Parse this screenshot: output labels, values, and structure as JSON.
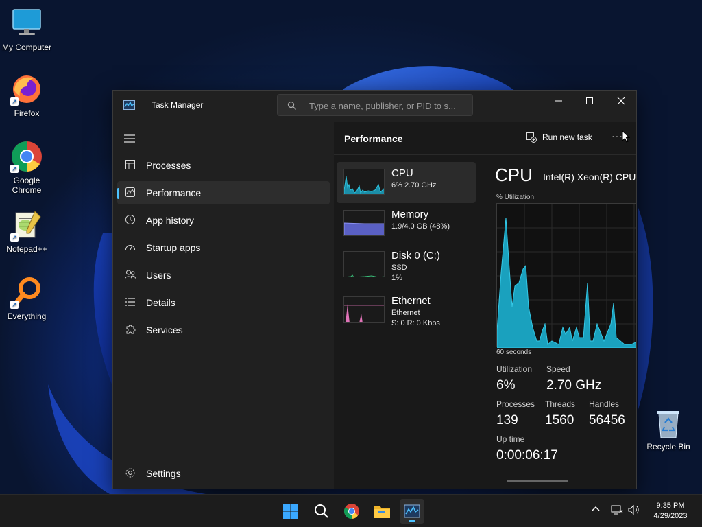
{
  "desktop": {
    "icons": [
      {
        "label": "My Computer",
        "icon": "monitor-icon"
      },
      {
        "label": "Firefox",
        "icon": "firefox-icon"
      },
      {
        "label": "Google\nChrome",
        "icon": "chrome-icon"
      },
      {
        "label": "Notepad++",
        "icon": "notepadpp-icon"
      },
      {
        "label": "Everything",
        "icon": "everything-icon"
      }
    ],
    "recycle_bin": "Recycle Bin"
  },
  "window": {
    "title": "Task Manager",
    "search_placeholder": "Type a name, publisher, or PID to s..."
  },
  "sidebar": {
    "items": [
      {
        "label": "Processes",
        "icon": "processes-icon"
      },
      {
        "label": "Performance",
        "icon": "performance-icon",
        "active": true
      },
      {
        "label": "App history",
        "icon": "history-icon"
      },
      {
        "label": "Startup apps",
        "icon": "speedometer-icon"
      },
      {
        "label": "Users",
        "icon": "users-icon"
      },
      {
        "label": "Details",
        "icon": "list-icon"
      },
      {
        "label": "Services",
        "icon": "puzzle-icon"
      }
    ],
    "settings": "Settings"
  },
  "main": {
    "title": "Performance",
    "run_new_task": "Run new task",
    "more": "···"
  },
  "resources": [
    {
      "name": "CPU",
      "line1": "6%  2.70 GHz",
      "line2": ""
    },
    {
      "name": "Memory",
      "line1": "1.9/4.0 GB (48%)",
      "line2": ""
    },
    {
      "name": "Disk 0 (C:)",
      "line1": "SSD",
      "line2": "1%"
    },
    {
      "name": "Ethernet",
      "line1": "Ethernet",
      "line2": "S: 0  R: 0 Kbps"
    }
  ],
  "cpu_detail": {
    "title": "CPU",
    "model": "Intel(R) Xeon(R) CPU",
    "util_label": "% Utilization",
    "time_label": "60 seconds",
    "utilization_label": "Utilization",
    "utilization": "6%",
    "speed_label": "Speed",
    "speed": "2.70 GHz",
    "processes_label": "Processes",
    "processes": "139",
    "threads_label": "Threads",
    "threads": "1560",
    "handles_label": "Handles",
    "handles": "56456",
    "uptime_label": "Up time",
    "uptime": "0:00:06:17"
  },
  "taskbar": {
    "apps": [
      "start-icon",
      "search-icon",
      "chrome-icon",
      "file-explorer-icon",
      "task-manager-icon"
    ],
    "time": "9:35 PM",
    "date": "4/29/2023"
  },
  "colors": {
    "accent": "#4cc2ff",
    "cpu_graph": "#17a2b8",
    "memory_graph": "#6a6fd8",
    "disk_graph": "#3bbf7a",
    "ethernet_graph": "#e073b8"
  }
}
